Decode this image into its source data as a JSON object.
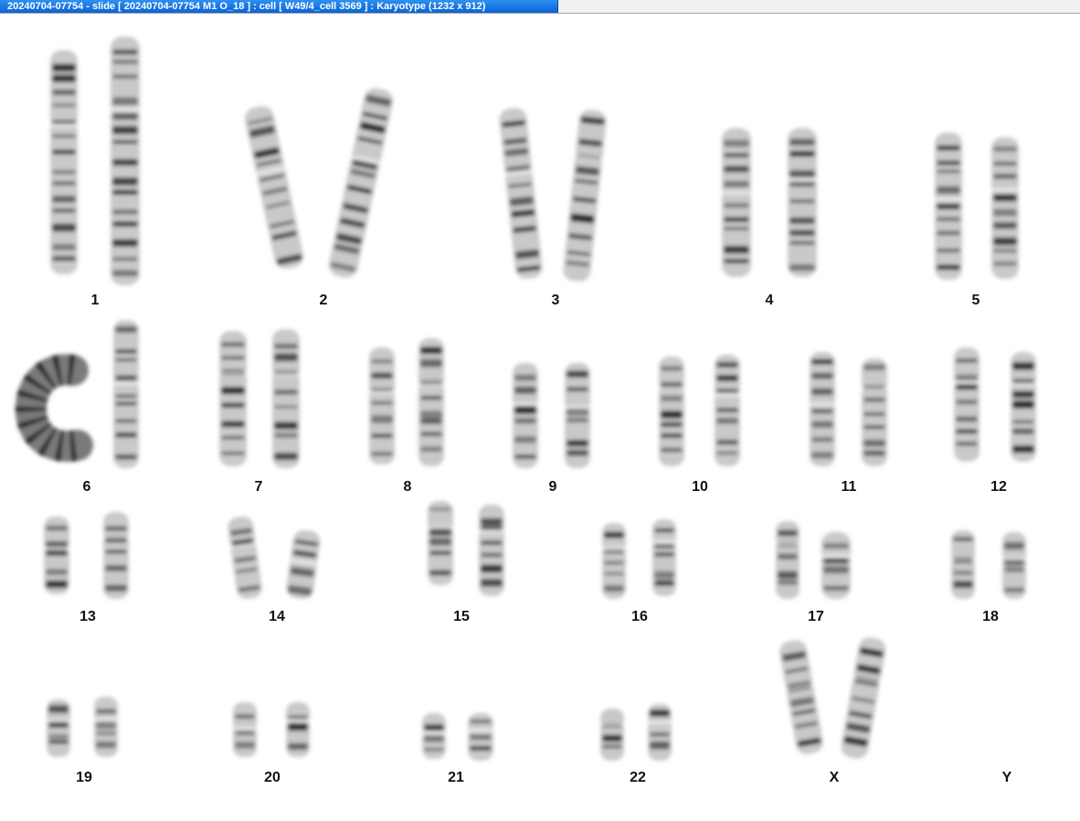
{
  "window": {
    "title": "20240704-07754 - slide [ 20240704-07754 M1 O_18 ] : cell [ W49/4_cell 3569 ] : Karyotype  (1232 x 912)"
  },
  "karyotype": {
    "labels": [
      "1",
      "2",
      "3",
      "4",
      "5",
      "6",
      "7",
      "8",
      "9",
      "10",
      "11",
      "12",
      "13",
      "14",
      "15",
      "16",
      "17",
      "18",
      "19",
      "20",
      "21",
      "22",
      "X",
      "Y"
    ]
  },
  "colors": {
    "background": "#ffffff",
    "title_tab": "#1a78e6",
    "chromosome_light": "#c9c9c9",
    "chromosome_dark": "#2b2b2b"
  }
}
